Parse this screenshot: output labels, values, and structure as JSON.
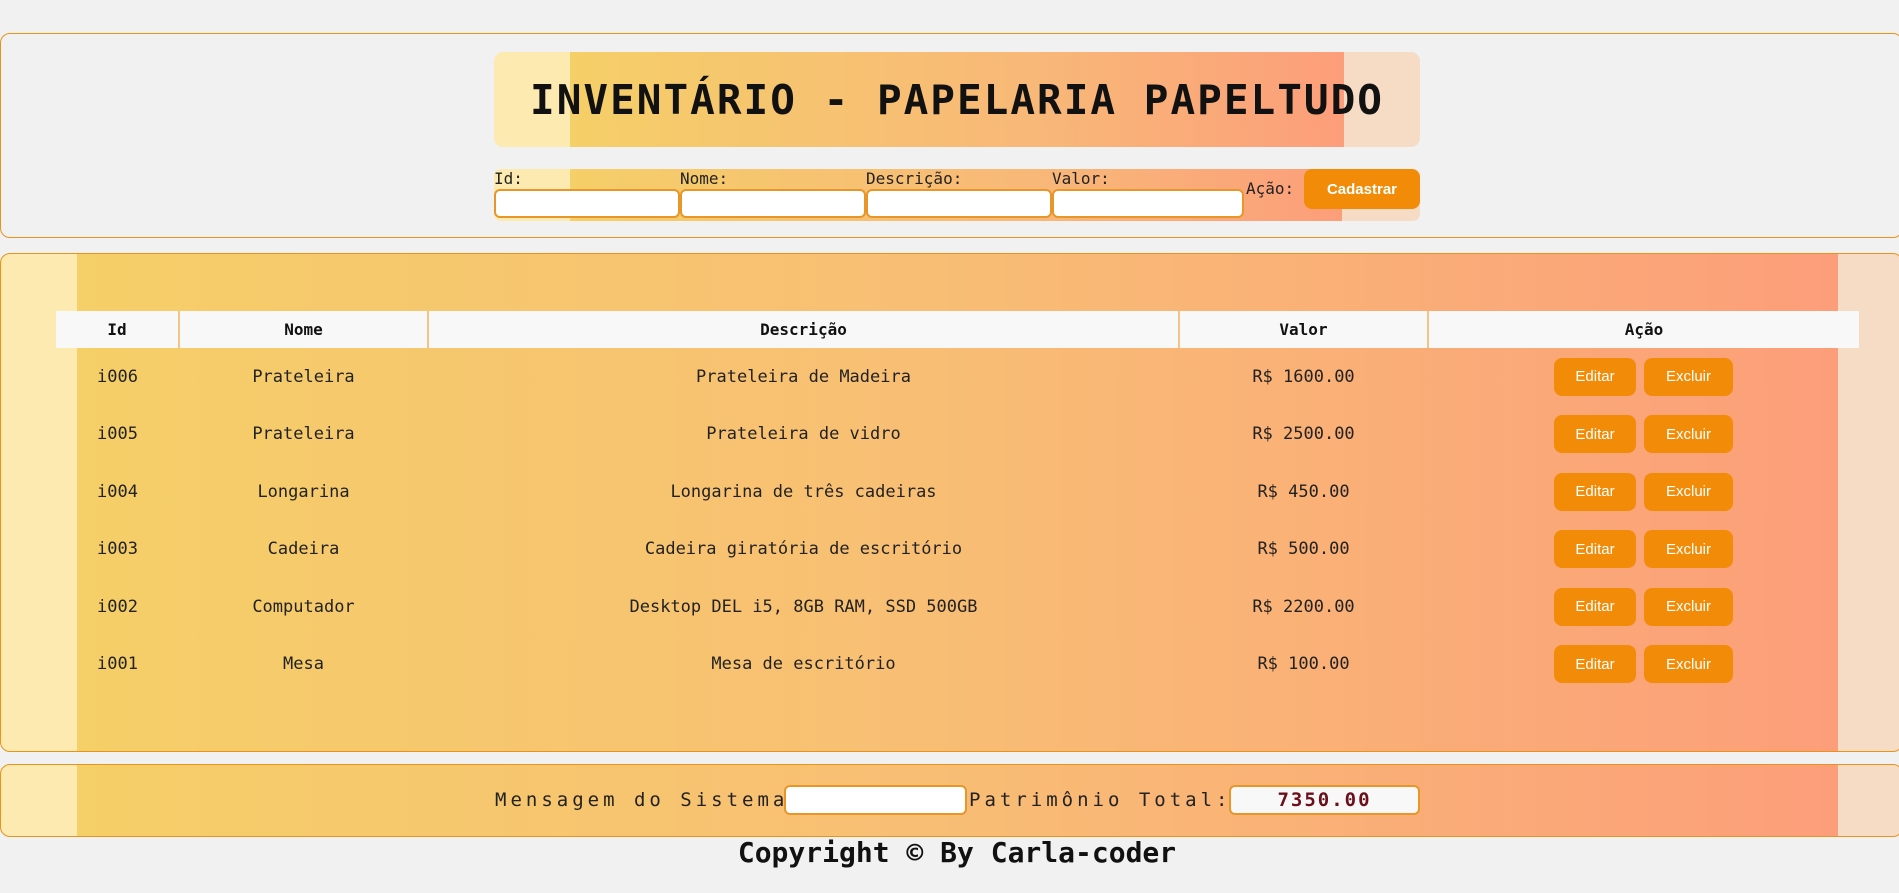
{
  "header": {
    "title": "INVENTÁRIO - PAPELARIA PAPELTUDO"
  },
  "form": {
    "id_label": "Id:",
    "nome_label": "Nome:",
    "descricao_label": "Descrição:",
    "valor_label": "Valor:",
    "acao_label": "Ação:",
    "submit_label": "Cadastrar"
  },
  "table": {
    "columns": [
      "Id",
      "Nome",
      "Descrição",
      "Valor",
      "Ação"
    ],
    "rows": [
      {
        "id": "i006",
        "nome": "Prateleira",
        "descricao": "Prateleira de Madeira",
        "valor": "R$ 1600.00",
        "edit_label": "Editar",
        "delete_label": "Excluir"
      },
      {
        "id": "i005",
        "nome": "Prateleira",
        "descricao": "Prateleira de vidro",
        "valor": "R$ 2500.00",
        "edit_label": "Editar",
        "delete_label": "Excluir"
      },
      {
        "id": "i004",
        "nome": "Longarina",
        "descricao": "Longarina de três cadeiras",
        "valor": "R$ 450.00",
        "edit_label": "Editar",
        "delete_label": "Excluir"
      },
      {
        "id": "i003",
        "nome": "Cadeira",
        "descricao": "Cadeira giratória de escritório",
        "valor": "R$ 500.00",
        "edit_label": "Editar",
        "delete_label": "Excluir"
      },
      {
        "id": "i002",
        "nome": "Computador",
        "descricao": "Desktop DEL i5, 8GB RAM, SSD 500GB",
        "valor": "R$ 2200.00",
        "edit_label": "Editar",
        "delete_label": "Excluir"
      },
      {
        "id": "i001",
        "nome": "Mesa",
        "descricao": "Mesa de escritório",
        "valor": "R$ 100.00",
        "edit_label": "Editar",
        "delete_label": "Excluir"
      }
    ]
  },
  "footer": {
    "message_label": "Mensagem do Sistema:",
    "message_value": "",
    "total_label": "Patrimônio Total:",
    "total_value": "7350.00",
    "copyright": "Copyright © By Carla-coder"
  },
  "colors": {
    "accent": "#f28c08",
    "border": "#e8931c"
  }
}
